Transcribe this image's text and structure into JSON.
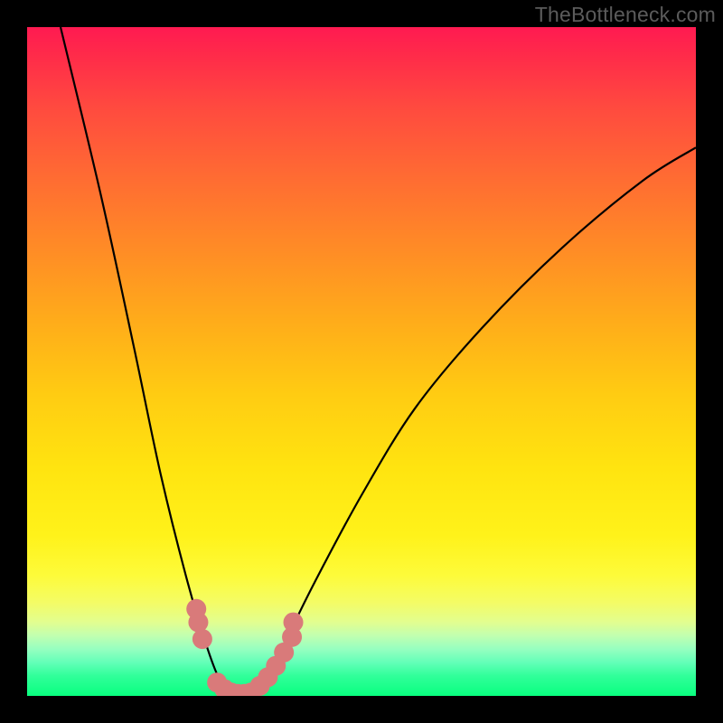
{
  "watermark": "TheBottleneck.com",
  "colors": {
    "frame": "#000000",
    "curve": "#000000",
    "marker_fill": "#d97a7a",
    "marker_stroke": "#c45f5f"
  },
  "chart_data": {
    "type": "line",
    "title": "",
    "xlabel": "",
    "ylabel": "",
    "xlim": [
      0,
      100
    ],
    "ylim": [
      0,
      100
    ],
    "grid": false,
    "curve_points": [
      {
        "x": 5,
        "y": 100
      },
      {
        "x": 11,
        "y": 75
      },
      {
        "x": 16,
        "y": 52
      },
      {
        "x": 20,
        "y": 33
      },
      {
        "x": 24,
        "y": 17
      },
      {
        "x": 27,
        "y": 7
      },
      {
        "x": 29,
        "y": 2
      },
      {
        "x": 31,
        "y": 0
      },
      {
        "x": 33,
        "y": 0
      },
      {
        "x": 35,
        "y": 2
      },
      {
        "x": 38,
        "y": 7
      },
      {
        "x": 43,
        "y": 17
      },
      {
        "x": 50,
        "y": 30
      },
      {
        "x": 58,
        "y": 43
      },
      {
        "x": 68,
        "y": 55
      },
      {
        "x": 80,
        "y": 67
      },
      {
        "x": 92,
        "y": 77
      },
      {
        "x": 100,
        "y": 82
      }
    ],
    "markers": [
      {
        "x": 25.3,
        "y": 13.0
      },
      {
        "x": 25.6,
        "y": 11.0
      },
      {
        "x": 26.2,
        "y": 8.5
      },
      {
        "x": 28.4,
        "y": 2.0
      },
      {
        "x": 29.5,
        "y": 1.0
      },
      {
        "x": 30.5,
        "y": 0.5
      },
      {
        "x": 31.5,
        "y": 0.3
      },
      {
        "x": 32.5,
        "y": 0.3
      },
      {
        "x": 33.5,
        "y": 0.5
      },
      {
        "x": 34.8,
        "y": 1.5
      },
      {
        "x": 36.0,
        "y": 2.8
      },
      {
        "x": 37.2,
        "y": 4.5
      },
      {
        "x": 38.4,
        "y": 6.5
      },
      {
        "x": 39.6,
        "y": 8.8
      },
      {
        "x": 39.8,
        "y": 11.0
      }
    ],
    "marker_radius_px": 11
  }
}
